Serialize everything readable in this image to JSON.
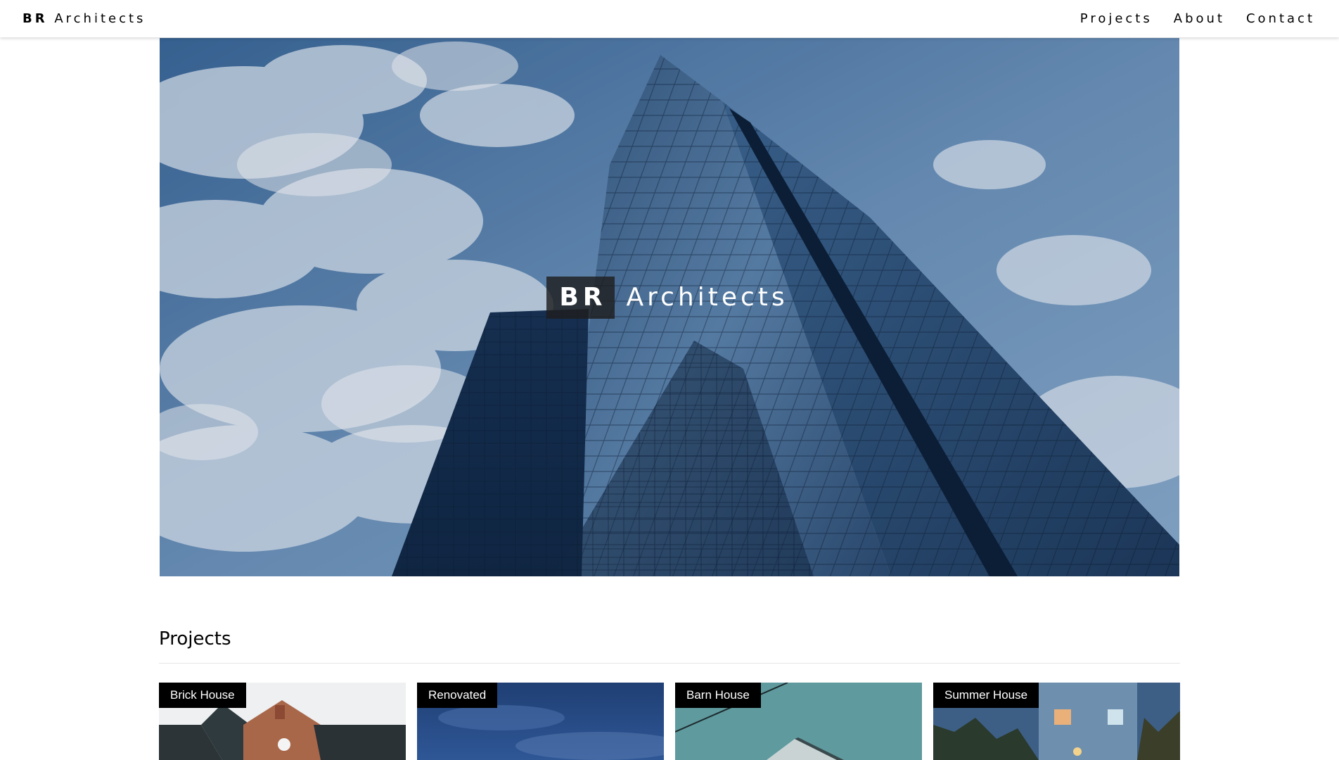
{
  "header": {
    "brand_bold": "BR",
    "brand_light": "Architects",
    "nav": [
      "Projects",
      "About",
      "Contact"
    ]
  },
  "hero": {
    "title_bold": "BR",
    "title_light": "Architects"
  },
  "projects": {
    "heading": "Projects",
    "cards": [
      {
        "label": "Brick House"
      },
      {
        "label": "Renovated"
      },
      {
        "label": "Barn House"
      },
      {
        "label": "Summer House"
      }
    ]
  }
}
